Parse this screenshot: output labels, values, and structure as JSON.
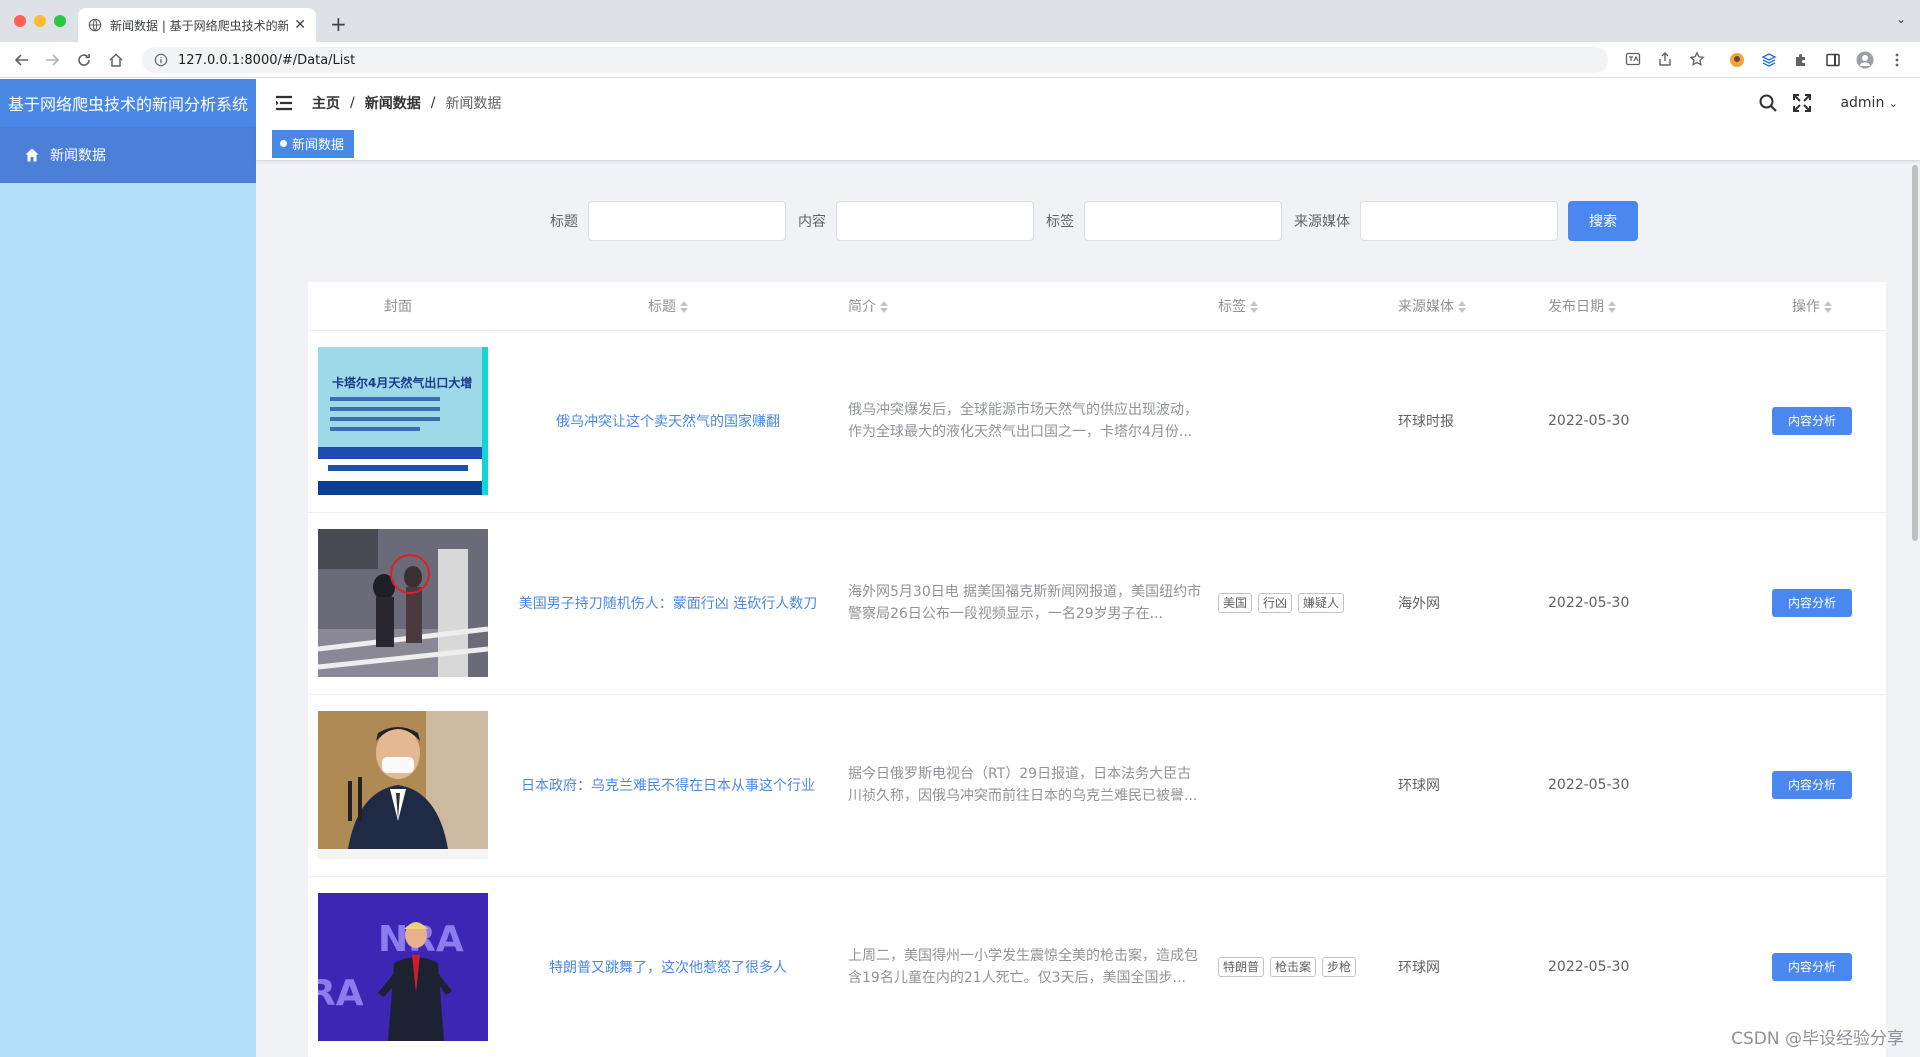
{
  "browser": {
    "tab_title": "新闻数据 | 基于网络爬虫技术的新闻分析系统",
    "url": "127.0.0.1:8000/#/Data/List"
  },
  "sidebar": {
    "logo": "基于网络爬虫技术的新闻分析系统",
    "items": [
      {
        "label": "新闻数据",
        "icon": "home-icon"
      }
    ]
  },
  "navbar": {
    "breadcrumb": [
      "主页",
      "新闻数据",
      "新闻数据"
    ],
    "user": "admin"
  },
  "tags_view": {
    "active": "新闻数据"
  },
  "search": {
    "fields": [
      {
        "label": "标题",
        "value": ""
      },
      {
        "label": "内容",
        "value": ""
      },
      {
        "label": "标签",
        "value": ""
      },
      {
        "label": "来源媒体",
        "value": ""
      }
    ],
    "button": "搜索"
  },
  "table": {
    "headers": [
      "封面",
      "标题",
      "简介",
      "标签",
      "来源媒体",
      "发布日期",
      "操作"
    ],
    "rows": [
      {
        "title": "俄乌冲突让这个卖天然气的国家赚翻",
        "summary": "俄乌冲突爆发后，全球能源市场天然气的供应出现波动，作为全球最大的液化天然气出口国之一，卡塔尔4月份...",
        "tags": [],
        "source": "环球时报",
        "date": "2022-05-30",
        "action": "内容分析",
        "cover_text": "卡塔尔4月天然气出口大增"
      },
      {
        "title": "美国男子持刀随机伤人：蒙面行凶 连砍行人数刀",
        "summary": "海外网5月30日电 据美国福克斯新闻网报道，美国纽约市警察局26日公布一段视频显示，一名29岁男子在...",
        "tags": [
          "美国",
          "行凶",
          "嫌疑人"
        ],
        "source": "海外网",
        "date": "2022-05-30",
        "action": "内容分析"
      },
      {
        "title": "日本政府：乌克兰难民不得在日本从事这个行业",
        "summary": "据今日俄罗斯电视台（RT）29日报道，日本法务大臣古川祯久称，因俄乌冲突而前往日本的乌克兰难民已被譽...",
        "tags": [],
        "source": "环球网",
        "date": "2022-05-30",
        "action": "内容分析"
      },
      {
        "title": "特朗普又跳舞了，这次他惹怒了很多人",
        "summary": "上周二，美国得州一小学发生震惊全美的枪击案，造成包含19名儿童在内的21人死亡。仅3天后，美国全国步...",
        "tags": [
          "特朗普",
          "枪击案",
          "步枪"
        ],
        "source": "环球网",
        "date": "2022-05-30",
        "action": "内容分析",
        "cover_text": "NRA"
      }
    ]
  },
  "watermark": "CSDN @毕设经验分享"
}
